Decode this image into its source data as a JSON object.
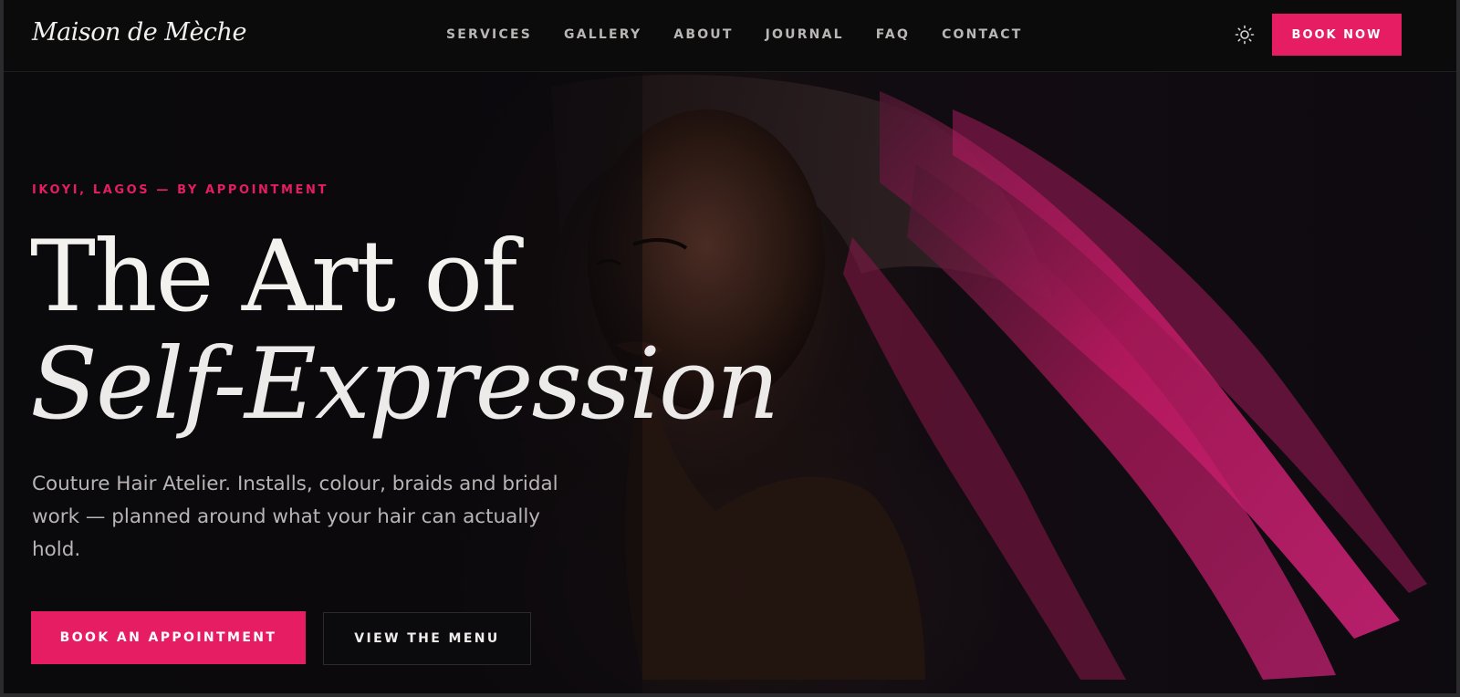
{
  "brand": {
    "name": "Maison de Mèche"
  },
  "nav": {
    "links": [
      "SERVICES",
      "GALLERY",
      "ABOUT",
      "JOURNAL",
      "FAQ",
      "CONTACT"
    ],
    "theme_icon": "sun-icon",
    "book_label": "BOOK NOW"
  },
  "hero": {
    "eyebrow": "IKOYI, LAGOS — BY APPOINTMENT",
    "headline_line1": "The Art of",
    "headline_line2": "Self-Expression",
    "subtext": "Couture Hair Atelier. Installs, colour, braids and bridal work — planned around what your hair can actually hold.",
    "primary_cta": "BOOK AN APPOINTMENT",
    "secondary_cta": "VIEW THE MENU"
  },
  "colors": {
    "accent": "#e61d63",
    "background": "#0b0a0c",
    "text": "#f4f2ef",
    "muted": "#b8b5b4"
  }
}
